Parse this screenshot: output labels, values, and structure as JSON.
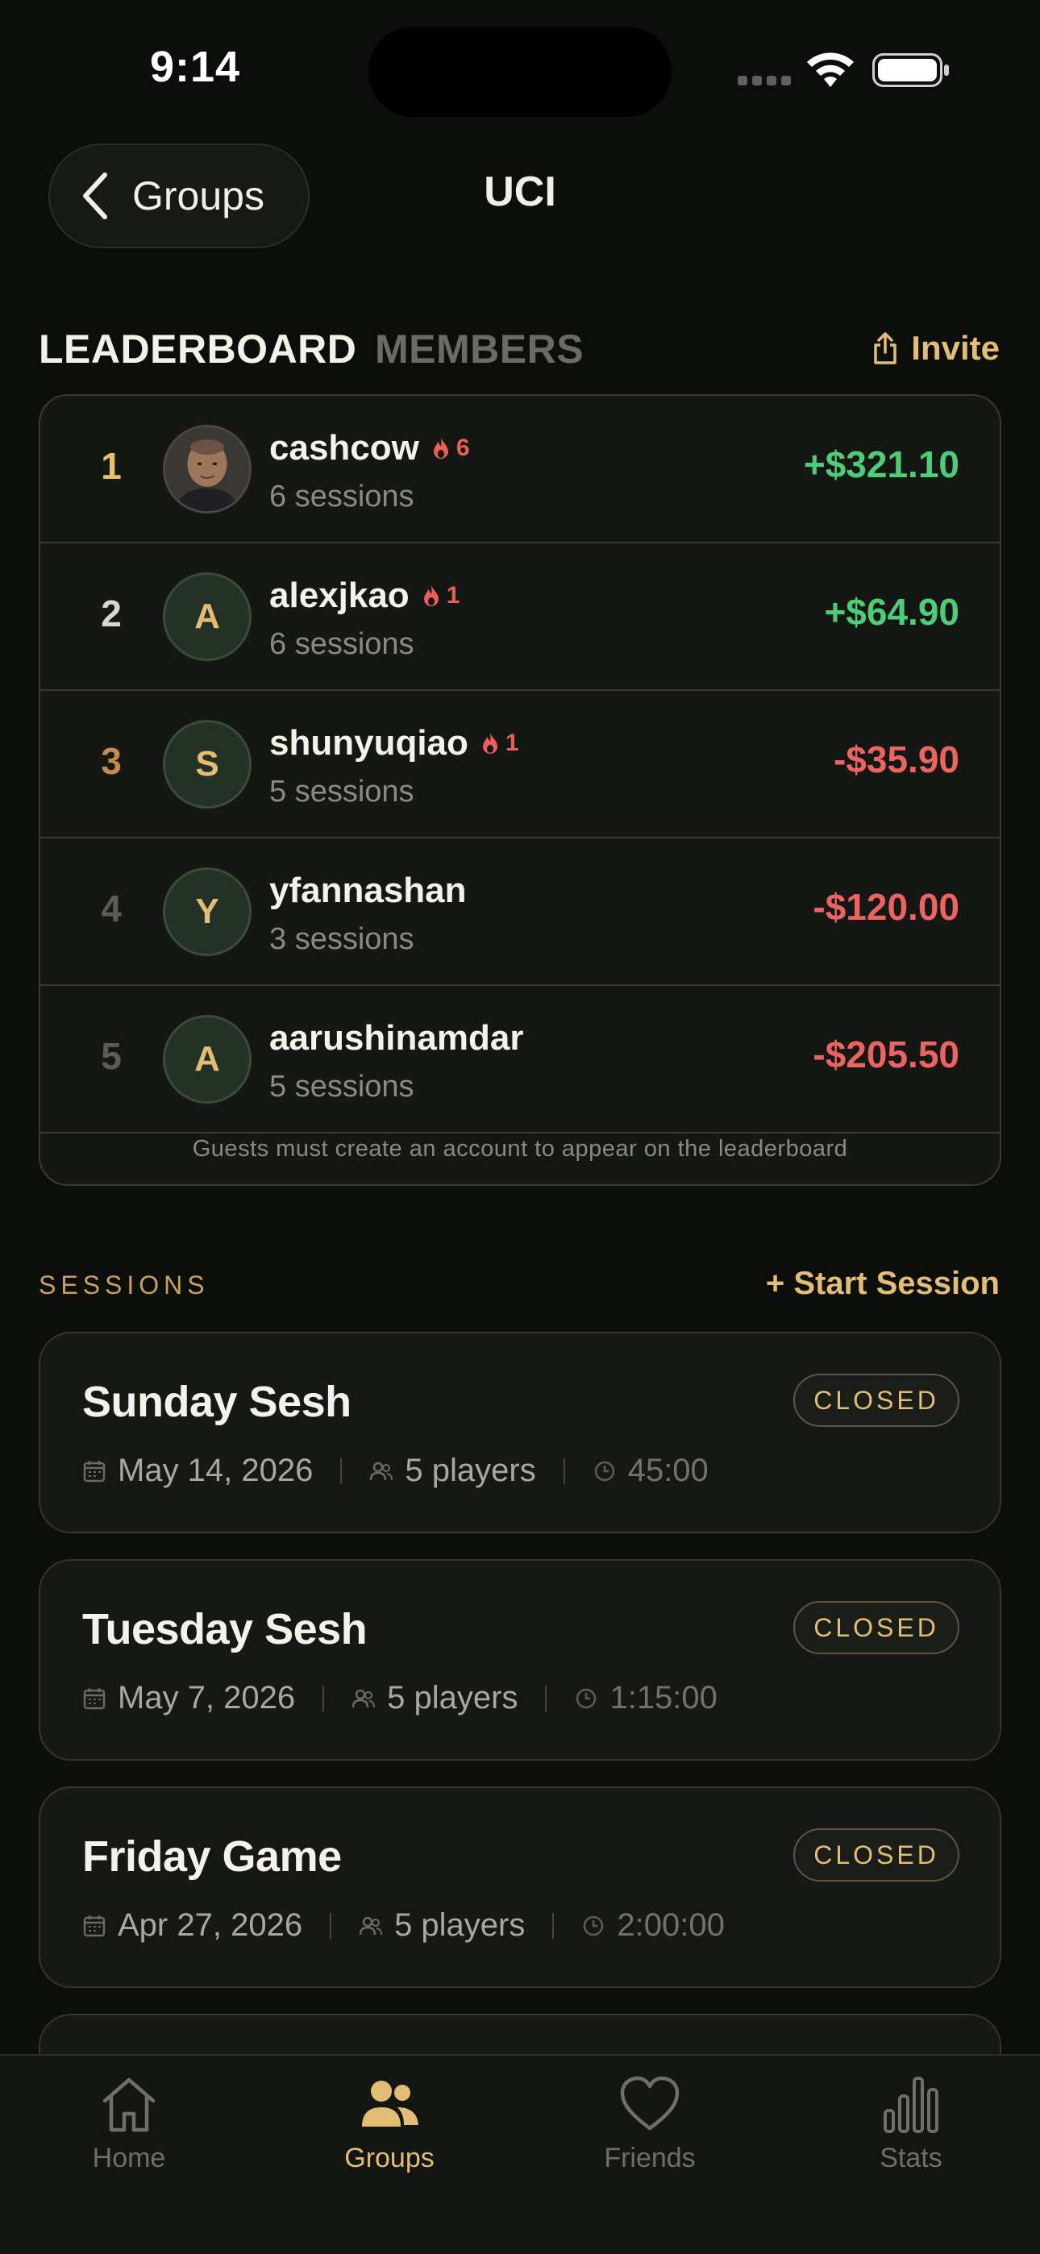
{
  "status_bar": {
    "time": "9:14"
  },
  "header": {
    "back_label": "Groups",
    "title": "UCI"
  },
  "tabs": {
    "leaderboard": "LEADERBOARD",
    "members": "MEMBERS",
    "invite": "Invite"
  },
  "leaderboard": {
    "rows": [
      {
        "rank": "1",
        "avatar": "",
        "name": "cashcow",
        "streak": "6",
        "sessions": "6 sessions",
        "amount": "+$321.10",
        "rank_color": "#e6c170"
      },
      {
        "rank": "2",
        "avatar": "A",
        "name": "alexjkao",
        "streak": "1",
        "sessions": "6 sessions",
        "amount": "+$64.90",
        "rank_color": "#d8d6cf"
      },
      {
        "rank": "3",
        "avatar": "S",
        "name": "shunyuqiao",
        "streak": "1",
        "sessions": "5 sessions",
        "amount": "-$35.90",
        "rank_color": "#c58a4c"
      },
      {
        "rank": "4",
        "avatar": "Y",
        "name": "yfannashan",
        "streak": "",
        "sessions": "3 sessions",
        "amount": "-$120.00",
        "rank_color": "#5c5c56"
      },
      {
        "rank": "5",
        "avatar": "A",
        "name": "aarushinamdar",
        "streak": "",
        "sessions": "5 sessions",
        "amount": "-$205.50",
        "rank_color": "#5c5c56"
      }
    ],
    "note": "Guests must create an account to appear on the leaderboard"
  },
  "sessions": {
    "header": "SESSIONS",
    "start_label": "+ Start Session",
    "items": [
      {
        "title": "Sunday Sesh",
        "status": "CLOSED",
        "date": "May 14, 2026",
        "players": "5 players",
        "duration": "45:00"
      },
      {
        "title": "Tuesday Sesh",
        "status": "CLOSED",
        "date": "May 7, 2026",
        "players": "5 players",
        "duration": "1:15:00"
      },
      {
        "title": "Friday Game",
        "status": "CLOSED",
        "date": "Apr 27, 2026",
        "players": "5 players",
        "duration": "2:00:00"
      }
    ]
  },
  "tabbar": {
    "home": "Home",
    "groups": "Groups",
    "friends": "Friends",
    "stats": "Stats"
  },
  "colors": {
    "accent": "#e4bd74",
    "positive": "#4ecd78",
    "negative": "#ec6461",
    "background": "#0c0e0c"
  }
}
